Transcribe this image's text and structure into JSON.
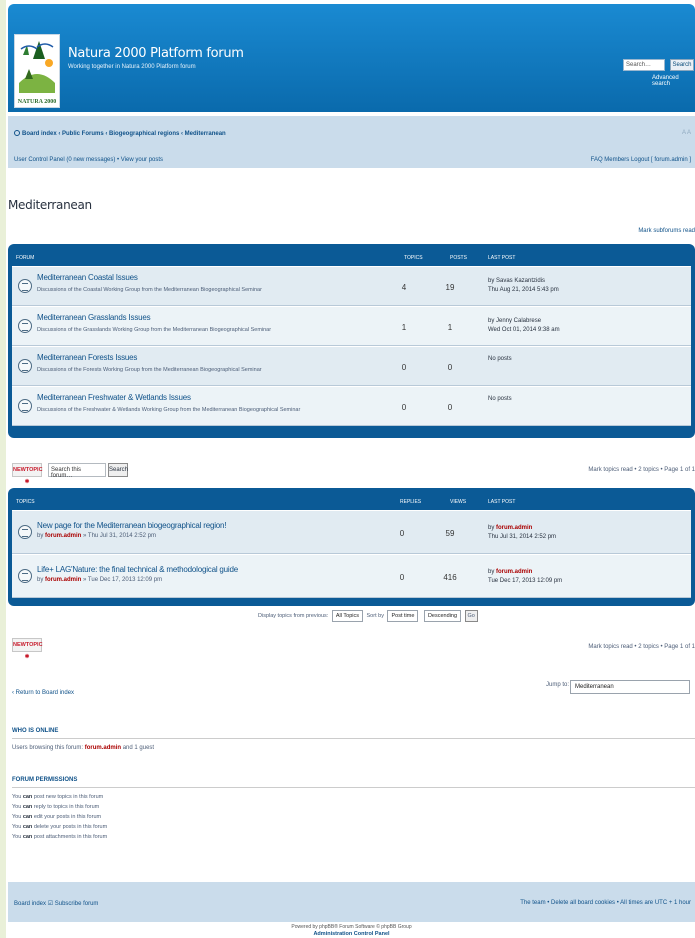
{
  "header": {
    "site_title": "Natura 2000 Platform forum",
    "site_desc": "Working together in Natura 2000 Platform forum",
    "logo_text": "NATURA 2000",
    "search_placeholder": "Search…",
    "search_button": "Search",
    "advanced_search": "Advanced search"
  },
  "nav": {
    "breadcrumb": "Board index ‹ Public Forums ‹ Biogeographical regions ‹ Mediterranean",
    "user_links": "User Control Panel (0 new messages) • View your posts",
    "right_links": "FAQ Members Logout [ forum.admin ]",
    "font_resize": "Change font size"
  },
  "page": {
    "title": "Mediterranean",
    "mark_subforums": "Mark subforums read"
  },
  "forum_list": {
    "headers": {
      "forum": "Forum",
      "topics": "Topics",
      "posts": "Posts",
      "last_post": "Last post"
    },
    "rows": [
      {
        "title": "Mediterranean Coastal Issues",
        "desc": "Discussions of the Coastal Working Group from the Mediterranean Biogeographical Seminar",
        "topics": "4",
        "posts": "19",
        "last_by": "by Savas Kazantzidis",
        "last_date": "Thu Aug 21, 2014 5:43 pm"
      },
      {
        "title": "Mediterranean Grasslands Issues",
        "desc": "Discussions of the Grasslands Working Group from the Mediterranean Biogeographical Seminar",
        "topics": "1",
        "posts": "1",
        "last_by": "by Jenny Calabrese",
        "last_date": "Wed Oct 01, 2014 9:38 am"
      },
      {
        "title": "Mediterranean Forests Issues",
        "desc": "Discussions of the Forests Working Group from the Mediterranean Biogeographical Seminar",
        "topics": "0",
        "posts": "0",
        "last_by": "No posts",
        "last_date": ""
      },
      {
        "title": "Mediterranean Freshwater & Wetlands Issues",
        "desc": "Discussions of the Freshwater & Wetlands Working Group from the Mediterranean Biogeographical Seminar",
        "topics": "0",
        "posts": "0",
        "last_by": "No posts",
        "last_date": ""
      }
    ]
  },
  "actions": {
    "new_topic": "NEWTOPIC ✱",
    "search_forum_placeholder": "Search this forum…",
    "search_forum_button": "Search",
    "pagination": "Mark topics read • 2 topics • Page 1 of 1"
  },
  "topic_list": {
    "headers": {
      "topics": "Topics",
      "replies": "Replies",
      "views": "Views",
      "last_post": "Last post"
    },
    "rows": [
      {
        "title": "New page for the Mediterranean biogeographical region!",
        "by_prefix": "by",
        "author": "forum.admin",
        "date": "» Thu Jul 31, 2014 2:52 pm",
        "replies": "0",
        "views": "59",
        "last_by_prefix": "by",
        "last_author": "forum.admin",
        "last_date": "Thu Jul 31, 2014 2:52 pm"
      },
      {
        "title": "Life+ LAG'Nature: the final technical & methodological guide",
        "by_prefix": "by",
        "author": "forum.admin",
        "date": "» Tue Dec 17, 2013 12:09 pm",
        "replies": "0",
        "views": "416",
        "last_by_prefix": "by",
        "last_author": "forum.admin",
        "last_date": "Tue Dec 17, 2013 12:09 pm"
      }
    ]
  },
  "display": {
    "label": "Display topics from previous:",
    "days": "All Topics",
    "sort_label": "Sort by",
    "sort_key": "Post time",
    "sort_dir": "Descending",
    "go": "Go"
  },
  "bottom": {
    "return_link": "‹ Return to Board index",
    "jump_label": "Jump to:",
    "jump_value": "Mediterranean",
    "go": "Go"
  },
  "who_is_online": {
    "title": "Who is online",
    "text_prefix": "Users browsing this forum:",
    "user": "forum.admin",
    "text_suffix": "and 1 guest"
  },
  "permissions": {
    "title": "Forum permissions",
    "lines": [
      {
        "pre": "You",
        "can": "can",
        "post": "post new topics in this forum"
      },
      {
        "pre": "You",
        "can": "can",
        "post": "reply to topics in this forum"
      },
      {
        "pre": "You",
        "can": "can",
        "post": "edit your posts in this forum"
      },
      {
        "pre": "You",
        "can": "can",
        "post": "delete your posts in this forum"
      },
      {
        "pre": "You",
        "can": "can",
        "post": "post attachments in this forum"
      }
    ]
  },
  "footer": {
    "left": "Board index ☑ Subscribe forum",
    "right": "The team • Delete all board cookies • All times are UTC + 1 hour",
    "powered": "Powered by phpBB® Forum Software © phpBB Group",
    "acp": "Administration Control Panel"
  },
  "colors": {
    "header_blue": "#0f7ac0",
    "list_header_blue": "#0b5a96",
    "nav_bg": "#cadceb",
    "row_bg": "#e1ebf2",
    "link": "#105289",
    "admin_red": "#aa0000",
    "newtopic_red": "#c71a2b"
  }
}
